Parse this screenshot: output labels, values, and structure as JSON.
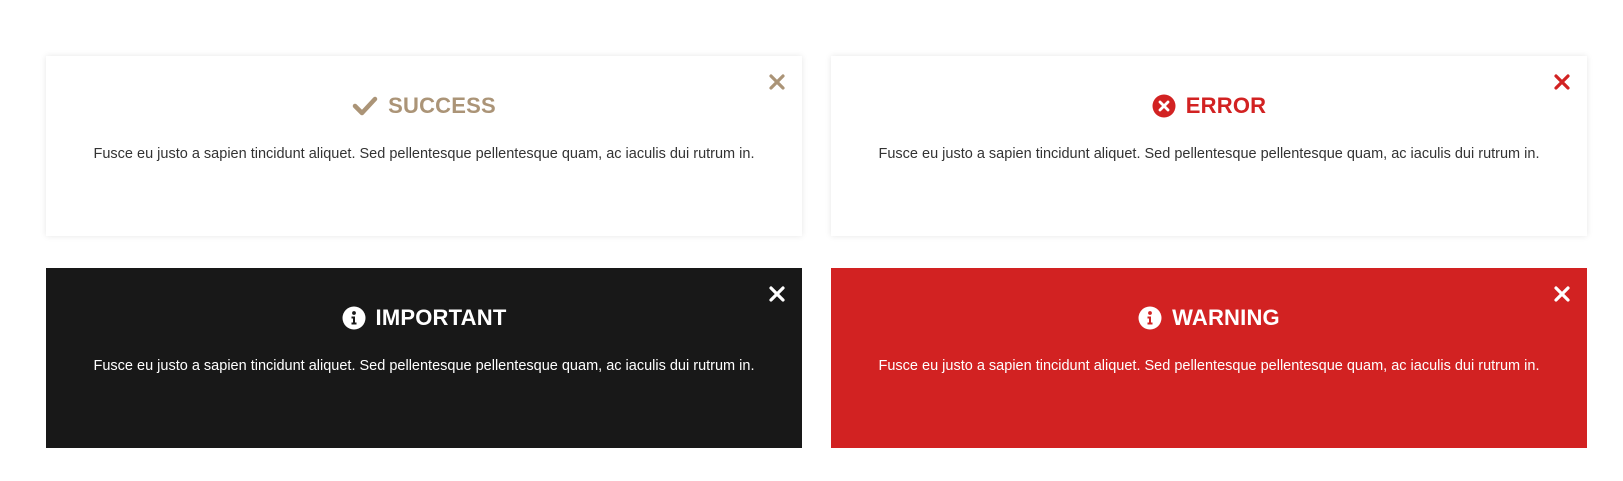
{
  "colors": {
    "success": "#ab9477",
    "error": "#d22222",
    "important_bg": "#181818",
    "warning_bg": "#d22222",
    "body_text": "#333333",
    "white": "#ffffff"
  },
  "alerts": [
    {
      "type": "success",
      "title": "SUCCESS",
      "icon": "check-icon",
      "message": "Fusce eu justo a sapien tincidunt aliquet. Sed pellentesque pellentesque quam, ac iaculis dui rutrum in."
    },
    {
      "type": "error",
      "title": "ERROR",
      "icon": "times-circle-icon",
      "message": "Fusce eu justo a sapien tincidunt aliquet. Sed pellentesque pellentesque quam, ac iaculis dui rutrum in."
    },
    {
      "type": "important",
      "title": "IMPORTANT",
      "icon": "info-circle-icon",
      "message": "Fusce eu justo a sapien tincidunt aliquet. Sed pellentesque pellentesque quam, ac iaculis dui rutrum in."
    },
    {
      "type": "warning",
      "title": "WARNING",
      "icon": "info-circle-icon",
      "message": "Fusce eu justo a sapien tincidunt aliquet. Sed pellentesque pellentesque quam, ac iaculis dui rutrum in."
    }
  ],
  "close_icon": "close-icon"
}
